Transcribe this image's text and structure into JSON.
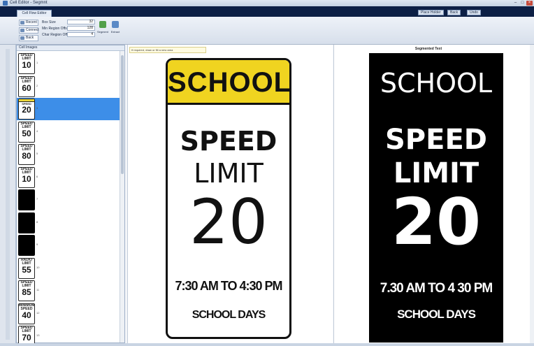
{
  "window": {
    "title": "Cell Editor - Segmnt"
  },
  "tabs": {
    "active": "Cell Flow Editor"
  },
  "header_buttons": [
    "Place Holder",
    "Back",
    "Undo"
  ],
  "ribbon": {
    "left_buttons": [
      "Recent",
      "Connect",
      "Back"
    ],
    "fields": [
      {
        "label": "Box Size",
        "value": "32"
      },
      {
        "label": "Min Region Offset",
        "value": "128"
      },
      {
        "label": "Char Region Offset",
        "value": "4"
      }
    ],
    "tools": [
      "Segment",
      "Extract"
    ]
  },
  "left_panel": {
    "header": "Cell Images",
    "items": [
      {
        "type": "sign",
        "line1": "SPEED",
        "line2": "LIMIT",
        "number": "10",
        "index": "1",
        "selected": false
      },
      {
        "type": "sign",
        "line1": "SPEED",
        "line2": "LIMIT",
        "number": "60",
        "index": "2",
        "selected": false
      },
      {
        "type": "school",
        "line1": "SPEED",
        "line2": "LIMIT",
        "number": "20",
        "index": "3",
        "selected": true
      },
      {
        "type": "sign",
        "line1": "SPEED",
        "line2": "LIMIT",
        "number": "50",
        "index": "4",
        "selected": false
      },
      {
        "type": "sign",
        "line1": "SPEED",
        "line2": "LIMIT",
        "number": "80",
        "index": "5",
        "selected": false
      },
      {
        "type": "sign",
        "line1": "SPEED",
        "line2": "LIMIT",
        "number": "10",
        "index": "6",
        "selected": false
      },
      {
        "type": "black",
        "line1": "",
        "line2": "",
        "number": "",
        "index": "7",
        "selected": false
      },
      {
        "type": "black",
        "line1": "",
        "line2": "",
        "number": "",
        "index": "8",
        "selected": false
      },
      {
        "type": "black",
        "line1": "",
        "line2": "",
        "number": "",
        "index": "9",
        "selected": false
      },
      {
        "type": "sign",
        "line1": "RADIO",
        "line2": "LIMIT",
        "number": "55",
        "index": "10",
        "selected": false
      },
      {
        "type": "sign",
        "line1": "SPEED",
        "line2": "LIMIT",
        "number": "85",
        "index": "11",
        "selected": false
      },
      {
        "type": "sign",
        "line1": "MINIMUM",
        "line2": "SPEED",
        "number": "40",
        "index": "12",
        "selected": false
      },
      {
        "type": "sign",
        "line1": "SPEED",
        "line2": "LIMIT",
        "number": "70",
        "index": "13",
        "selected": false
      }
    ]
  },
  "center_panel": {
    "note": "If required, draw or fill a new area",
    "sign": {
      "header": "SCHOOL",
      "line1": "SPEED",
      "line2": "LIMIT",
      "number": "20",
      "hours": "7:30 AM TO 4:30 PM",
      "days": "SCHOOL DAYS"
    }
  },
  "right_panel": {
    "title": "Segmented Text",
    "sign": {
      "header": "SCHOOL",
      "line1": "SPEED",
      "line2": "LIMIT",
      "number": "20",
      "hours": "7.30 AM TO 4 30 PM",
      "days": "SCHOOL DAYS"
    }
  },
  "colors": {
    "selection": "#3d8ee8",
    "school_yellow": "#f0d420",
    "title_band": "#0c1f45"
  }
}
